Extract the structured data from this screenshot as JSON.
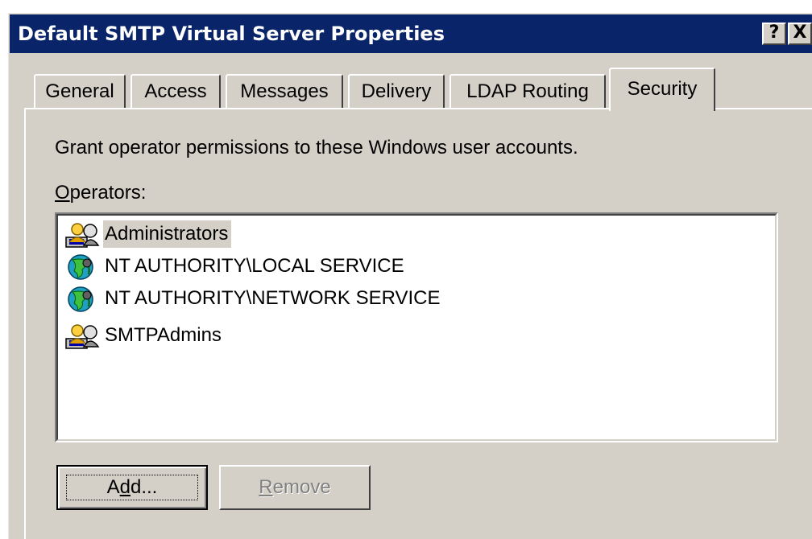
{
  "window": {
    "title": "Default SMTP Virtual Server Properties",
    "help_button": "?",
    "close_button": "X"
  },
  "tabs": [
    {
      "label": "General",
      "active": false
    },
    {
      "label": "Access",
      "active": false
    },
    {
      "label": "Messages",
      "active": false
    },
    {
      "label": "Delivery",
      "active": false
    },
    {
      "label": "LDAP Routing",
      "active": false
    },
    {
      "label": "Security",
      "active": true
    }
  ],
  "security": {
    "description": "Grant operator permissions to these Windows user accounts.",
    "operators_label_mnemonic": "O",
    "operators_label_rest": "perators:",
    "operators": [
      {
        "name": "Administrators",
        "icon": "user-group-icon",
        "selected": true
      },
      {
        "name": "NT AUTHORITY\\LOCAL SERVICE",
        "icon": "globe-icon",
        "selected": false
      },
      {
        "name": "NT AUTHORITY\\NETWORK SERVICE",
        "icon": "globe-icon",
        "selected": false
      },
      {
        "name": "SMTPAdmins",
        "icon": "user-group-icon",
        "selected": false
      }
    ],
    "add_button": {
      "pre": "A",
      "mnemonic": "d",
      "post": "d...",
      "enabled": true
    },
    "remove_button": {
      "mnemonic": "R",
      "post": "emove",
      "enabled": false
    }
  },
  "colors": {
    "titlebar": "#0a246a",
    "face": "#d4d0c8",
    "disabled_text": "#808080"
  }
}
